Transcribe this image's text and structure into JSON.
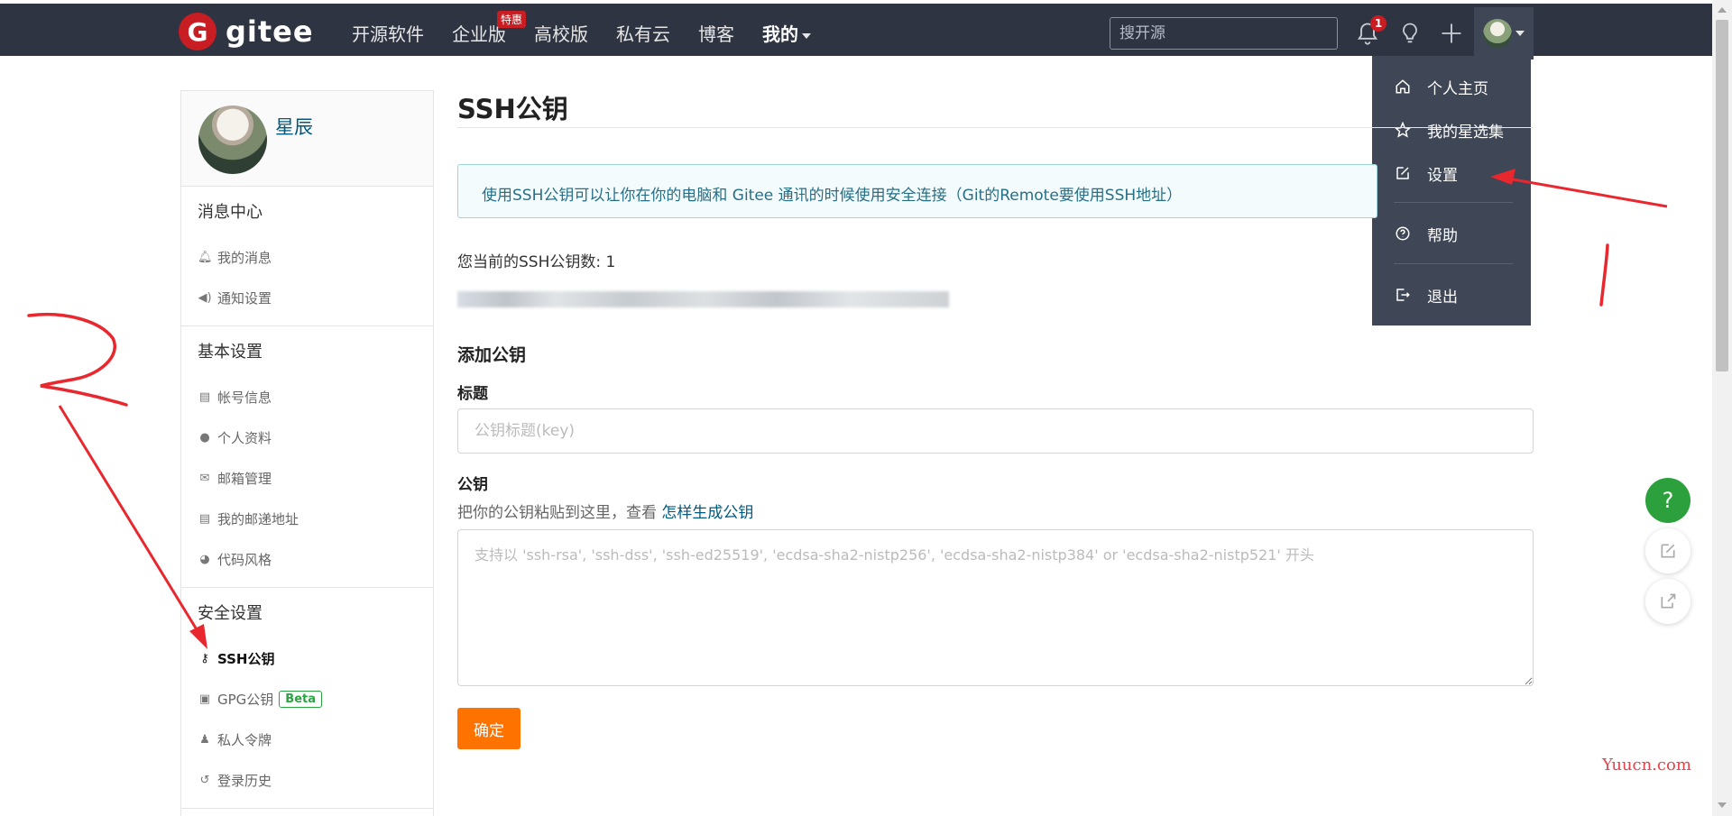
{
  "topbar": {
    "brand": "gitee",
    "logo_letter": "G",
    "nav": [
      {
        "label": "开源软件"
      },
      {
        "label": "企业版",
        "badge": "特惠"
      },
      {
        "label": "高校版"
      },
      {
        "label": "私有云"
      },
      {
        "label": "博客"
      },
      {
        "label": "我的"
      }
    ],
    "search_placeholder": "搜开源",
    "notification_count": "1",
    "icons": [
      "bell-icon",
      "lightbulb-icon",
      "plus-icon",
      "avatar"
    ]
  },
  "dropdown": {
    "items": [
      {
        "label": "个人主页",
        "icon": "home-icon"
      },
      {
        "label": "我的星选集",
        "icon": "star-icon"
      },
      {
        "label": "设置",
        "icon": "edit-icon"
      },
      {
        "label": "帮助",
        "icon": "question-circle-icon"
      },
      {
        "label": "退出",
        "icon": "logout-icon"
      }
    ]
  },
  "sidebar": {
    "username": "星辰",
    "sections": [
      {
        "title": "消息中心",
        "items": [
          {
            "label": "我的消息",
            "icon": "bell-icon"
          },
          {
            "label": "通知设置",
            "icon": "speaker-icon"
          }
        ]
      },
      {
        "title": "基本设置",
        "items": [
          {
            "label": "帐号信息",
            "icon": "id-card-icon"
          },
          {
            "label": "个人资料",
            "icon": "user-icon"
          },
          {
            "label": "邮箱管理",
            "icon": "mail-icon"
          },
          {
            "label": "我的邮递地址",
            "icon": "id-card-icon"
          },
          {
            "label": "代码风格",
            "icon": "palette-icon"
          }
        ]
      },
      {
        "title": "安全设置",
        "items": [
          {
            "label": "SSH公钥",
            "icon": "key-icon",
            "active": true
          },
          {
            "label": "GPG公钥",
            "icon": "lock-icon",
            "badge": "Beta"
          },
          {
            "label": "私人令牌",
            "icon": "user-secret-icon"
          },
          {
            "label": "登录历史",
            "icon": "history-icon"
          }
        ]
      }
    ]
  },
  "main": {
    "title": "SSH公钥",
    "info": "使用SSH公钥可以让你在你的电脑和 Gitee 通讯的时候使用安全连接（Git的Remote要使用SSH地址）",
    "count_text": "您当前的SSH公钥数: 1",
    "add_title": "添加公钥",
    "title_label": "标题",
    "title_placeholder": "公钥标题(key)",
    "key_label": "公钥",
    "key_help": "把你的公钥粘贴到这里，查看 ",
    "key_help_link": "怎样生成公钥",
    "key_placeholder": "支持以 'ssh-rsa', 'ssh-dss', 'ssh-ed25519', 'ecdsa-sha2-nistp256', 'ecdsa-sha2-nistp384' or 'ecdsa-sha2-nistp521' 开头",
    "submit": "确定"
  },
  "float": {
    "help": "?"
  },
  "watermark": "Yuucn.com",
  "colors": {
    "brand": "#c71d23",
    "nav_bg": "#2e3441",
    "submit": "#fe7300",
    "link": "#005980",
    "annotation": "#e8282e"
  }
}
